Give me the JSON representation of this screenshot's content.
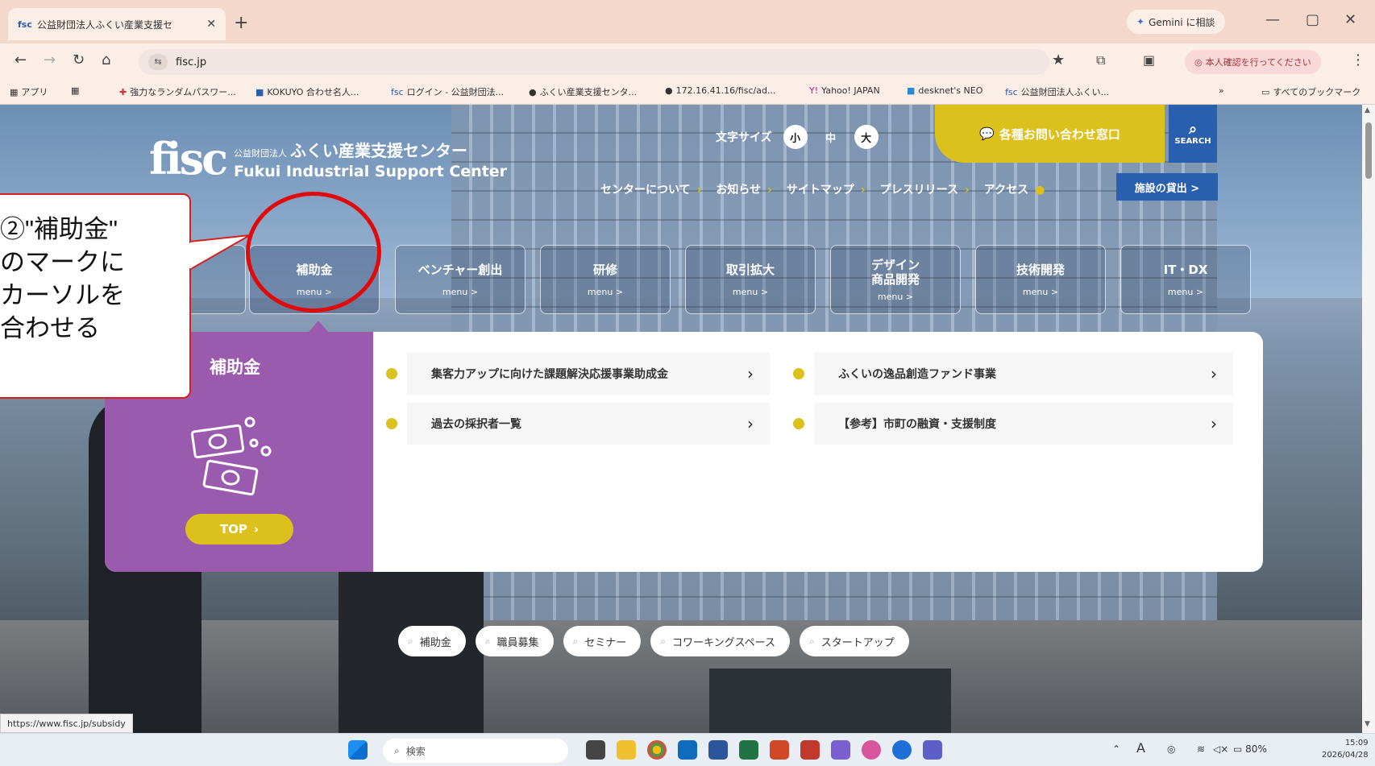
{
  "browser": {
    "tab_title": "公益財団法人ふくい産業支援セ",
    "tab_favicon": "fsc",
    "new_tab": "+",
    "gemini_label": "Gemini に相談",
    "minimize": "—",
    "restore": "▢",
    "close": "✕",
    "url": "fisc.jp",
    "profile_label": "本人確認を行ってください",
    "bookmarks": [
      {
        "icon": "▦",
        "label": "アプリ"
      },
      {
        "icon": "▦",
        "label": ""
      },
      {
        "icon": "✚",
        "label": "強力なランダムパスワー..."
      },
      {
        "icon": "■",
        "label": "KOKUYO 合わせ名人..."
      },
      {
        "icon": "fsc",
        "label": "ログイン - 公益財団法..."
      },
      {
        "icon": "●",
        "label": "ふくい産業支援センタ..."
      },
      {
        "icon": "●",
        "label": "172.16.41.16/fisc/ad..."
      },
      {
        "icon": "Y!",
        "label": "Yahoo! JAPAN"
      },
      {
        "icon": "■",
        "label": "desknet's NEO"
      },
      {
        "icon": "fsc",
        "label": "公益財団法人ふくい..."
      }
    ],
    "bookmarks_more": "»",
    "all_bookmarks": "すべてのブックマーク",
    "status_url": "https://www.fisc.jp/subsidy"
  },
  "site": {
    "logo_mark": "fisc",
    "logo_small": "公益財団法人",
    "logo_jp": "ふくい産業支援センター",
    "logo_en": "Fukui Industrial Support Center",
    "fontsize_label": "文字サイズ",
    "fontsize_small": "小",
    "fontsize_mid": "中",
    "fontsize_large": "大",
    "contact_label": "各種お問い合わせ窓口",
    "search_label": "SEARCH",
    "gnav": [
      "センターについて",
      "お知らせ",
      "サイトマップ",
      "プレスリリース",
      "アクセス"
    ],
    "facility_label": "施設の貸出 >",
    "tiles": [
      {
        "label": "補助金",
        "sub": "menu >"
      },
      {
        "label": "ベンチャー創出",
        "sub": "menu >"
      },
      {
        "label": "研修",
        "sub": "menu >"
      },
      {
        "label": "取引拡大",
        "sub": "menu >"
      },
      {
        "label": "デザイン\n商品開発",
        "sub": "menu >"
      },
      {
        "label": "技術開発",
        "sub": "menu >"
      },
      {
        "label": "IT・DX",
        "sub": "menu >"
      }
    ],
    "panel": {
      "title": "補助金",
      "top_button": "TOP",
      "links": [
        "集客力アップに向けた課題解決応援事業助成金",
        "ふくいの逸品創造ファンド事業",
        "過去の採択者一覧",
        "【参考】市町の融資・支援制度"
      ]
    },
    "tags": [
      "補助金",
      "職員募集",
      "セミナー",
      "コワーキングスペース",
      "スタートアップ"
    ]
  },
  "annotation": {
    "text": "②\"補助金\"\nのマークに\nカーソルを\n合わせる",
    "color": "#e10a0a"
  },
  "taskbar": {
    "search_placeholder": "検索",
    "tray_ime": "A",
    "tray_battery": "80%",
    "time": "15:09",
    "date": "2026/04/28"
  }
}
